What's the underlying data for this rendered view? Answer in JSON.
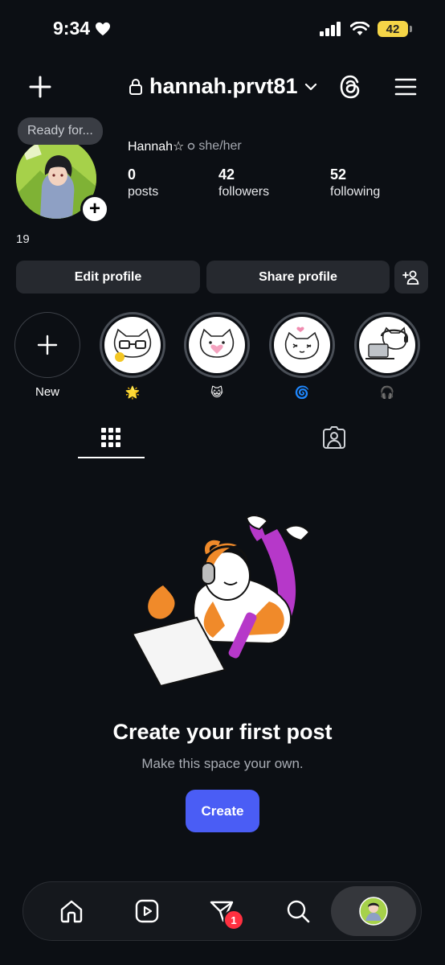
{
  "status_bar": {
    "time": "9:34",
    "battery": "42"
  },
  "header": {
    "username": "hannah.prvt81"
  },
  "profile": {
    "note": "Ready for...",
    "display_name": "Hannah☆",
    "pronouns": "she/her",
    "stats": [
      {
        "num": "0",
        "label": "posts"
      },
      {
        "num": "42",
        "label": "followers"
      },
      {
        "num": "52",
        "label": "following"
      }
    ],
    "bio": "19",
    "edit_label": "Edit profile",
    "share_label": "Share profile"
  },
  "highlights": [
    {
      "label": "New"
    },
    {
      "label": "🌟"
    },
    {
      "label": "😺"
    },
    {
      "label": "🌀"
    },
    {
      "label": "🎧"
    }
  ],
  "empty_state": {
    "title": "Create your first post",
    "subtitle": "Make this space your own.",
    "create_label": "Create"
  },
  "nav": {
    "notification_count": "1"
  },
  "colors": {
    "background": "#0c0f14",
    "button": "#26292f",
    "accent": "#4a5df5",
    "badge": "#ff3040"
  }
}
